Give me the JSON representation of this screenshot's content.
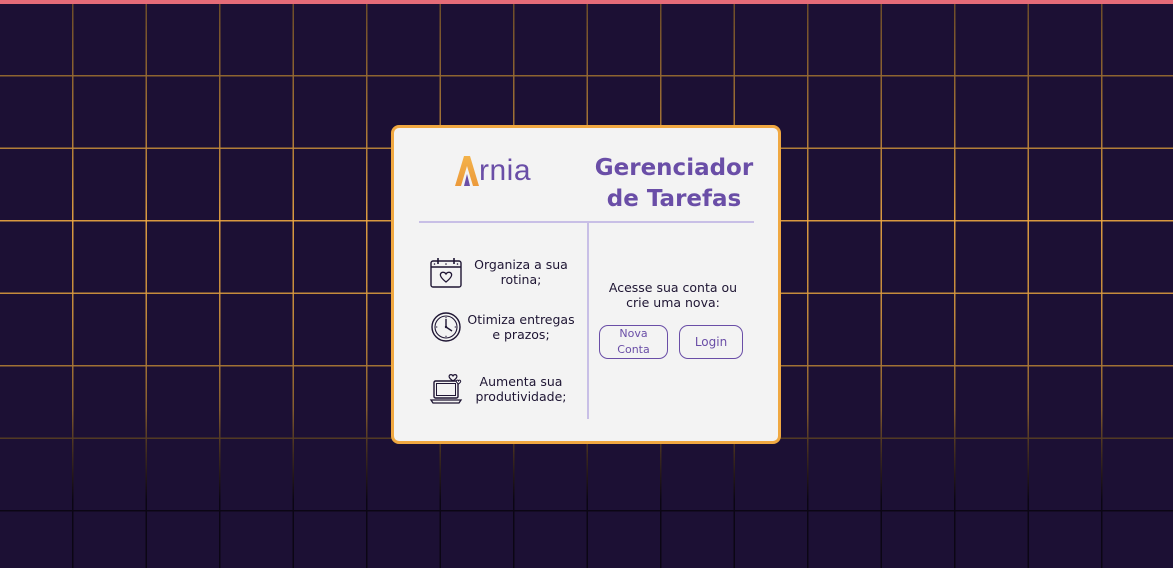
{
  "brand": {
    "logo_text": "rnia",
    "logo_mark_letter": "A",
    "colors": {
      "primary": "#6a4ea7",
      "accent": "#f0a841",
      "background": "#1c1034",
      "card": "#f3f3f3",
      "top_bar": "#e56b78"
    }
  },
  "card": {
    "title_line1": "Gerenciador",
    "title_line2": "de Tarefas",
    "features": [
      {
        "icon": "calendar-heart-icon",
        "text": "Organiza a sua rotina;"
      },
      {
        "icon": "clock-icon",
        "text": "Otimiza entregas e prazos;"
      },
      {
        "icon": "laptop-heart-icon",
        "text": "Aumenta sua produtividade;"
      }
    ],
    "access_text": "Acesse sua conta ou crie uma nova:",
    "buttons": {
      "new_account": "Nova Conta",
      "login": "Login"
    }
  }
}
